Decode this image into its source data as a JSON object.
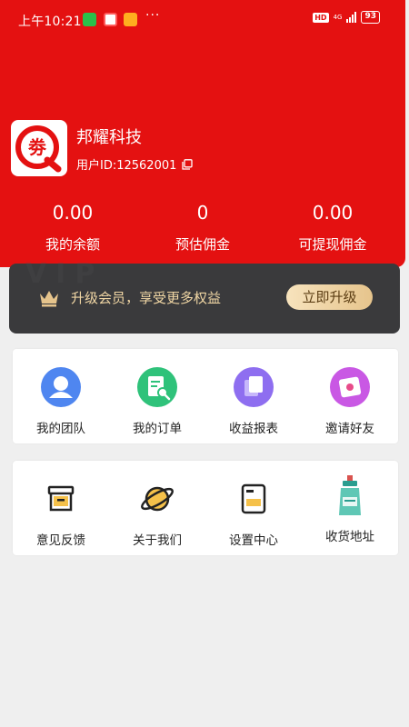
{
  "status_bar": {
    "time": "上午10:21",
    "dots": "···",
    "hd": "HD",
    "network": "4G",
    "battery": "93"
  },
  "profile": {
    "name": "邦耀科技",
    "user_id": "用户ID:12562001",
    "logo_glyph": "劵"
  },
  "stats": [
    {
      "value": "0.00",
      "label": "我的余额"
    },
    {
      "value": "0",
      "label": "预估佣金"
    },
    {
      "value": "0.00",
      "label": "可提现佣金"
    }
  ],
  "vip": {
    "watermark": "VIP",
    "text": "升级会员，享受更多权益",
    "button": "立即升级"
  },
  "menu1": [
    {
      "label": "我的团队",
      "icon": "team-icon"
    },
    {
      "label": "我的订单",
      "icon": "order-icon"
    },
    {
      "label": "收益报表",
      "icon": "report-icon"
    },
    {
      "label": "邀请好友",
      "icon": "invite-icon"
    }
  ],
  "menu2": [
    {
      "label": "意见反馈",
      "icon": "feedback-icon"
    },
    {
      "label": "关于我们",
      "icon": "about-icon"
    },
    {
      "label": "设置中心",
      "icon": "settings-icon"
    },
    {
      "label": "收货地址",
      "icon": "address-icon"
    }
  ],
  "colors": {
    "header": "#e41111",
    "vip_bg": "#3a3a3c",
    "vip_gold": "#f0d6a4"
  }
}
